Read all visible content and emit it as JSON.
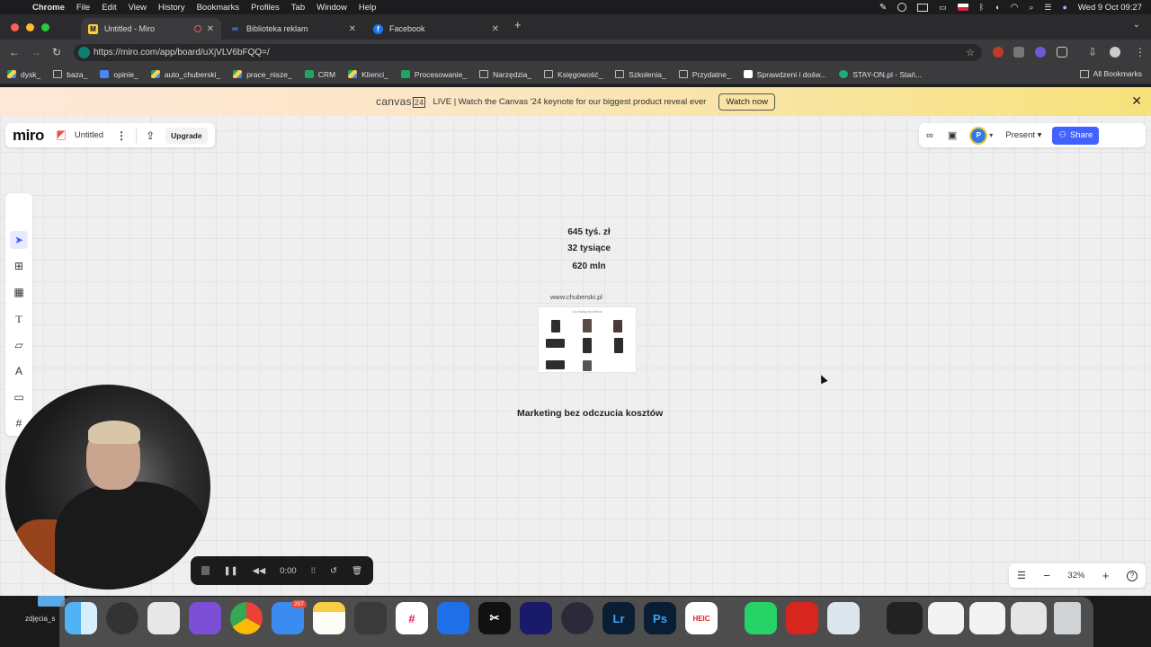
{
  "menubar": {
    "app": "Chrome",
    "items": [
      "File",
      "Edit",
      "View",
      "History",
      "Bookmarks",
      "Profiles",
      "Tab",
      "Window",
      "Help"
    ],
    "clock": "Wed 9 Oct  09:27"
  },
  "tabs": [
    {
      "label": "Untitled - Miro",
      "favicon": "miro-icon",
      "active": true
    },
    {
      "label": "Biblioteka reklam",
      "favicon": "meta-icon",
      "active": false
    },
    {
      "label": "Facebook",
      "favicon": "facebook-icon",
      "active": false
    }
  ],
  "address": {
    "url": "https://miro.com/app/board/uXjVLV6bFQQ=/"
  },
  "bookmarks": [
    "dysk_",
    "baza_",
    "opinie_",
    "auto_chuberski_",
    "prace_nisze_",
    "CRM",
    "Klienci_",
    "Procesowanie_",
    "Narzędzia_",
    "Księgowość_",
    "Szkolenia_",
    "Przydatne_",
    "Sprawdzeni i dośw...",
    "STAY-ON.pl - Stań..."
  ],
  "all_bookmarks": "All Bookmarks",
  "banner": {
    "logo_text": "canvas",
    "logo_year": "24",
    "message": "LIVE | Watch the Canvas '24 keynote for our biggest product reveal ever",
    "button": "Watch now"
  },
  "miro": {
    "logo": "miro",
    "board_title": "Untitled",
    "upgrade": "Upgrade",
    "avatar_initial": "P",
    "present": "Present",
    "share": "Share",
    "zoom": "32%"
  },
  "board": {
    "line1": "645 tyś. zł",
    "line2": "32 tysiące",
    "line3": "620 mln",
    "url_note": "www.chuberski.pl",
    "frame_title": "Co mówią moi klienci",
    "headline": "Marketing bez odczucia kosztów"
  },
  "recorder": {
    "time": "0:00"
  },
  "dock": {
    "mail_badge": "207",
    "desktop_label": "zdjęcia_s"
  },
  "colors": {
    "miro_blue": "#4262ff",
    "banner_yellow": "#f6e27a"
  }
}
